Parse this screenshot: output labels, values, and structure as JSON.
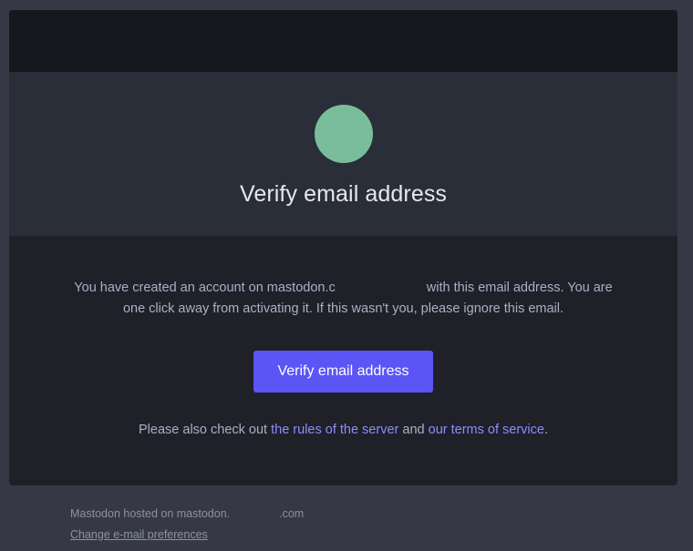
{
  "email": {
    "title": "Verify email address",
    "message_part1": "You have created an account on mastodon.",
    "message_part1_tail": "c",
    "message_part2": "with this email address. You are one click away from activating it. If this wasn't you, please ignore this email.",
    "cta_label": "Verify email address",
    "also_prefix": "Please also check out",
    "rules_link": "the rules of the server",
    "also_and": "and",
    "terms_link": "our terms of service",
    "also_suffix": "."
  },
  "footer": {
    "hosted_prefix": "Mastodon hosted on mastodon.",
    "hosted_suffix": ".com",
    "preferences_link": "Change e-mail preferences"
  },
  "colors": {
    "page_bg": "#363945",
    "card_bg": "#1f2028",
    "hero_bg": "#2a2e38",
    "avatar": "#79bd9a",
    "cta": "#5b55f5",
    "link": "#8c8dff"
  }
}
